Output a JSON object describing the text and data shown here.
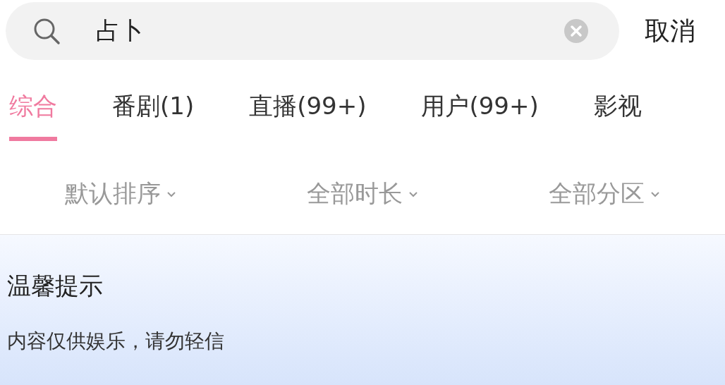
{
  "search": {
    "value": "占卜"
  },
  "cancel": "取消",
  "tabs": [
    {
      "label": "综合",
      "selected": true
    },
    {
      "label": "番剧(1)",
      "selected": false
    },
    {
      "label": "直播(99+)",
      "selected": false
    },
    {
      "label": "用户(99+)",
      "selected": false
    },
    {
      "label": "影视",
      "selected": false
    }
  ],
  "filters": [
    "默认排序",
    "全部时长",
    "全部分区"
  ],
  "notice": {
    "title": "温馨提示",
    "text": "内容仅供娱乐，请勿轻信"
  }
}
